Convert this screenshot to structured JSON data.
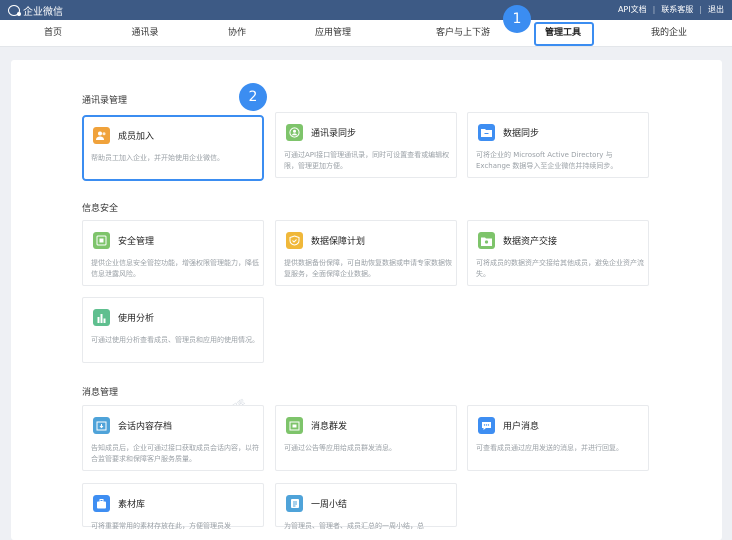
{
  "topbar": {
    "app_name": "企业微信",
    "links": [
      "API文档",
      "联系客服",
      "退出"
    ]
  },
  "nav": {
    "items": [
      "首页",
      "通讯录",
      "协作",
      "应用管理",
      "客户与上下游",
      "管理工具",
      "我的企业"
    ],
    "active": "管理工具"
  },
  "badges": [
    "1",
    "2"
  ],
  "sections": [
    {
      "title": "通讯录管理",
      "cards": [
        {
          "title": "成员加入",
          "desc": "帮助员工加入企业，并开始使用企业微信。",
          "icon": "users-icon",
          "color": "#f0a23b"
        },
        {
          "title": "通讯录同步",
          "desc": "可通过API接口管理通讯录，同时可设置查看或编辑权限，管理更加方便。",
          "icon": "user-circle-icon",
          "color": "#7ec46b"
        },
        {
          "title": "数据同步",
          "desc": "可将企业的 Microsoft Active Directory 与 Exchange 数据导入至企业微信并持续同步。",
          "icon": "folder-sync-icon",
          "color": "#3e8ef2"
        }
      ]
    },
    {
      "title": "信息安全",
      "cards": [
        {
          "title": "安全管理",
          "desc": "提供企业信息安全管控功能，增强权限管理能力，降低信息泄露风险。",
          "icon": "shield-icon",
          "color": "#7ec46b"
        },
        {
          "title": "数据保障计划",
          "desc": "提供数据备份保障，可自助恢复数据或申请专家数据恢复服务，全面保障企业数据。",
          "icon": "data-guard-icon",
          "color": "#f0b83a"
        },
        {
          "title": "数据资产交接",
          "desc": "可将成员的数据资产交接给其他成员，避免企业资产流失。",
          "icon": "handover-icon",
          "color": "#7ec46b"
        },
        {
          "title": "使用分析",
          "desc": "可通过使用分析查看成员、管理员和应用的使用情况。",
          "icon": "bar-chart-icon",
          "color": "#5fbf8f"
        }
      ]
    },
    {
      "title": "消息管理",
      "cards": [
        {
          "title": "会话内容存档",
          "desc": "告知成员后，企业可通过接口获取成员会话内容，以符合监管要求和保障客户服务质量。",
          "icon": "archive-icon",
          "color": "#4fa3d9"
        },
        {
          "title": "消息群发",
          "desc": "可通过公告等应用给成员群发消息。",
          "icon": "broadcast-icon",
          "color": "#7ec46b"
        },
        {
          "title": "用户消息",
          "desc": "可查看成员通过应用发送的消息，并进行回复。",
          "icon": "chat-bubble-icon",
          "color": "#3e8ef2"
        },
        {
          "title": "素材库",
          "desc": "可将重要常用的素材存放在此，方便管理员发",
          "icon": "briefcase-icon",
          "color": "#3e8ef2"
        },
        {
          "title": "一周小结",
          "desc": "为管理员、管理者、成员汇总的一周小结，总",
          "icon": "weekly-summary-icon",
          "color": "#4fa3d9"
        }
      ]
    }
  ]
}
